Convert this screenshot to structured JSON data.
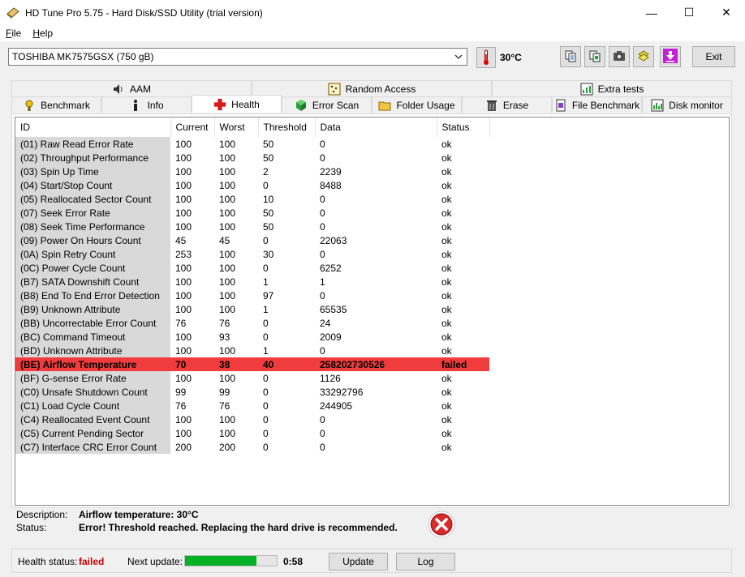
{
  "window": {
    "title": "HD Tune Pro 5.75 - Hard Disk/SSD Utility (trial version)",
    "minimize_glyph": "—",
    "maximize_glyph": "☐",
    "close_glyph": "✕"
  },
  "menu": [
    {
      "label": "File"
    },
    {
      "label": "Help"
    }
  ],
  "toolbar": {
    "drive": "TOSHIBA MK7575GSX (750 gB)",
    "temperature": "30°C",
    "exit_label": "Exit",
    "icons": [
      "copy-text-icon",
      "copy-screenshot-icon",
      "camera-icon",
      "options-icon",
      "save-down-icon"
    ]
  },
  "tabs_top": [
    {
      "label": "AAM",
      "icon": "speaker-icon"
    },
    {
      "label": "Random Access",
      "icon": "random-access-icon"
    },
    {
      "label": "Extra tests",
      "icon": "extra-tests-icon"
    }
  ],
  "tabs_bottom": [
    {
      "label": "Benchmark",
      "icon": "benchmark-icon"
    },
    {
      "label": "Info",
      "icon": "info-icon"
    },
    {
      "label": "Health",
      "icon": "health-cross-icon",
      "active": true
    },
    {
      "label": "Error Scan",
      "icon": "error-scan-icon"
    },
    {
      "label": "Folder Usage",
      "icon": "folder-icon"
    },
    {
      "label": "Erase",
      "icon": "trash-icon"
    },
    {
      "label": "File Benchmark",
      "icon": "file-benchmark-icon"
    },
    {
      "label": "Disk monitor",
      "icon": "disk-monitor-icon"
    }
  ],
  "table": {
    "headers": [
      "ID",
      "Current",
      "Worst",
      "Threshold",
      "Data",
      "Status"
    ],
    "rows": [
      [
        "(01) Raw Read Error Rate",
        "100",
        "100",
        "50",
        "0",
        "ok"
      ],
      [
        "(02) Throughput Performance",
        "100",
        "100",
        "50",
        "0",
        "ok"
      ],
      [
        "(03) Spin Up Time",
        "100",
        "100",
        "2",
        "2239",
        "ok"
      ],
      [
        "(04) Start/Stop Count",
        "100",
        "100",
        "0",
        "8488",
        "ok"
      ],
      [
        "(05) Reallocated Sector Count",
        "100",
        "100",
        "10",
        "0",
        "ok"
      ],
      [
        "(07) Seek Error Rate",
        "100",
        "100",
        "50",
        "0",
        "ok"
      ],
      [
        "(08) Seek Time Performance",
        "100",
        "100",
        "50",
        "0",
        "ok"
      ],
      [
        "(09) Power On Hours Count",
        "45",
        "45",
        "0",
        "22063",
        "ok"
      ],
      [
        "(0A) Spin Retry Count",
        "253",
        "100",
        "30",
        "0",
        "ok"
      ],
      [
        "(0C) Power Cycle Count",
        "100",
        "100",
        "0",
        "6252",
        "ok"
      ],
      [
        "(B7) SATA Downshift Count",
        "100",
        "100",
        "1",
        "1",
        "ok"
      ],
      [
        "(B8) End To End Error Detection",
        "100",
        "100",
        "97",
        "0",
        "ok"
      ],
      [
        "(B9) Unknown Attribute",
        "100",
        "100",
        "1",
        "65535",
        "ok"
      ],
      [
        "(BB) Uncorrectable Error Count",
        "76",
        "76",
        "0",
        "24",
        "ok"
      ],
      [
        "(BC) Command Timeout",
        "100",
        "93",
        "0",
        "2009",
        "ok"
      ],
      [
        "(BD) Unknown Attribute",
        "100",
        "100",
        "1",
        "0",
        "ok"
      ],
      [
        "(BE) Airflow Temperature",
        "70",
        "38",
        "40",
        "258202730526",
        "failed"
      ],
      [
        "(BF) G-sense Error Rate",
        "100",
        "100",
        "0",
        "1126",
        "ok"
      ],
      [
        "(C0) Unsafe Shutdown Count",
        "99",
        "99",
        "0",
        "33292796",
        "ok"
      ],
      [
        "(C1) Load Cycle Count",
        "76",
        "76",
        "0",
        "244905",
        "ok"
      ],
      [
        "(C4) Reallocated Event Count",
        "100",
        "100",
        "0",
        "0",
        "ok"
      ],
      [
        "(C5) Current Pending Sector",
        "100",
        "100",
        "0",
        "0",
        "ok"
      ],
      [
        "(C7) Interface CRC Error Count",
        "200",
        "200",
        "0",
        "0",
        "ok"
      ]
    ],
    "failed_row_color": "#f03c3c"
  },
  "description": {
    "desc_label": "Description:",
    "desc_value": "Airflow temperature: 30°C",
    "status_label": "Status:",
    "status_value": "Error! Threshold reached. Replacing the hard drive is recommended."
  },
  "statusbar": {
    "health_label": "Health status:",
    "health_value": "failed",
    "next_update_label": "Next update:",
    "progress_fraction": 0.78,
    "countdown": "0:58",
    "update_label": "Update",
    "log_label": "Log"
  }
}
